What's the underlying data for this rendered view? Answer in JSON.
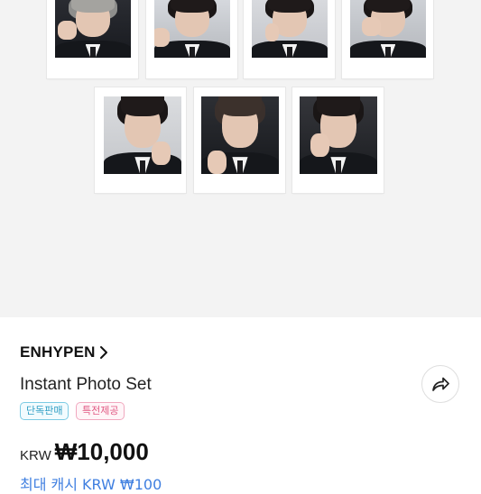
{
  "product": {
    "brand": "ENHYPEN",
    "title": "Instant Photo Set",
    "badges": [
      "단독판매",
      "특전제공"
    ],
    "price_currency": "KRW",
    "price_amount": "₩10,000",
    "cashback": "최대 캐시 KRW ₩100"
  },
  "icons": {
    "brand_link": "chevron-right-icon",
    "share": "share-arrow-icon"
  },
  "colors": {
    "gallery_background": "#f3f3f3",
    "badge_exclusive": "#2f9ec4",
    "badge_benefit": "#e15a84",
    "cashback_text": "#3f7fe0"
  }
}
